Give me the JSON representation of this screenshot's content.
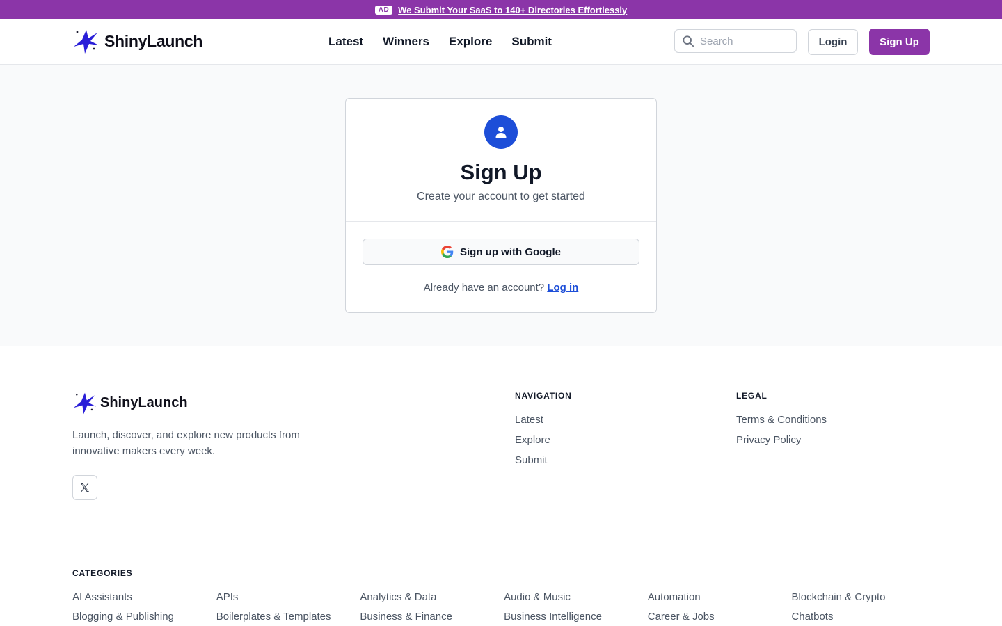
{
  "ad": {
    "badge": "AD",
    "text": "We Submit Your SaaS to 140+ Directories Effortlessly"
  },
  "header": {
    "logo": "ShinyLaunch",
    "nav": [
      "Latest",
      "Winners",
      "Explore",
      "Submit"
    ],
    "search_placeholder": "Search",
    "login": "Login",
    "signup": "Sign Up"
  },
  "card": {
    "title": "Sign Up",
    "subtitle": "Create your account to get started",
    "google_button": "Sign up with Google",
    "login_prompt": "Already have an account?",
    "login_link": "Log in"
  },
  "footer": {
    "logo": "ShinyLaunch",
    "description": "Launch, discover, and explore new products from innovative makers every week.",
    "navigation_heading": "NAVIGATION",
    "navigation": [
      "Latest",
      "Explore",
      "Submit"
    ],
    "legal_heading": "LEGAL",
    "legal": [
      "Terms & Conditions",
      "Privacy Policy"
    ],
    "categories_heading": "CATEGORIES",
    "categories": [
      "AI Assistants",
      "APIs",
      "Analytics & Data",
      "Audio & Music",
      "Automation",
      "Blockchain & Crypto",
      "Blogging & Publishing",
      "Boilerplates & Templates",
      "Business & Finance",
      "Business Intelligence",
      "Career & Jobs",
      "Chatbots"
    ]
  },
  "colors": {
    "brand": "#8b35a8",
    "accent_blue": "#1d4ed8"
  }
}
